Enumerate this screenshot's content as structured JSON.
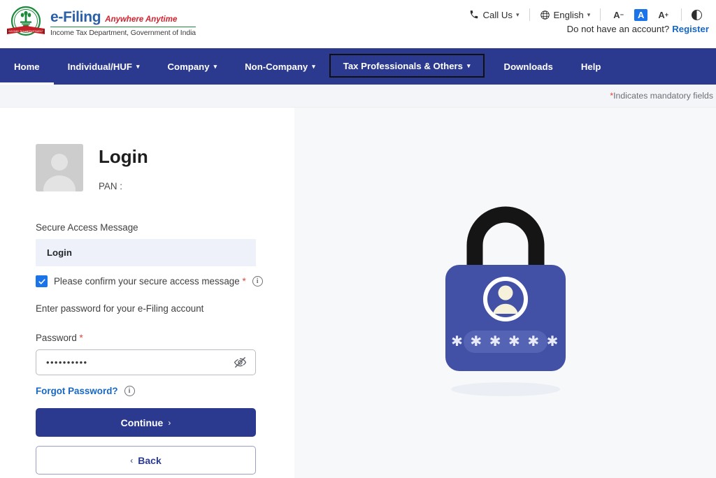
{
  "header": {
    "logo": {
      "emblem_alt": "income-tax-department-emblem",
      "title": "e-Filing",
      "tagline": "Anywhere Anytime",
      "subtitle": "Income Tax Department, Government of India"
    },
    "utilities": [
      {
        "id": "call-us",
        "label": "Call Us",
        "icon": "phone-icon",
        "has_caret": true
      },
      {
        "id": "language",
        "label": "English",
        "icon": "globe-icon",
        "has_caret": true
      }
    ],
    "font_size_controls": {
      "decrease": "A",
      "decrease_sup": "−",
      "normal": "A",
      "increase": "A",
      "increase_sup": "+",
      "active": "normal"
    },
    "contrast_toggle": "contrast-icon",
    "account_prompt": "Do not have an account?",
    "register_label": "Register"
  },
  "nav": {
    "items": [
      {
        "label": "Home",
        "caret": false,
        "state": "active"
      },
      {
        "label": "Individual/HUF",
        "caret": true,
        "state": "normal"
      },
      {
        "label": "Company",
        "caret": true,
        "state": "normal"
      },
      {
        "label": "Non-Company",
        "caret": true,
        "state": "normal"
      },
      {
        "label": "Tax Professionals & Others",
        "caret": true,
        "state": "focused"
      },
      {
        "label": "Downloads",
        "caret": false,
        "state": "normal"
      },
      {
        "label": "Help",
        "caret": false,
        "state": "normal"
      }
    ],
    "background": "#2b3a8f"
  },
  "mandatory": {
    "asterisk": "*",
    "text": " Indicates mandatory fields"
  },
  "login": {
    "title": "Login",
    "pan_label": "PAN :",
    "pan_value": "",
    "secure_access": {
      "label": "Secure Access Message",
      "value": "Login",
      "confirm_label": "Please confirm your secure access message",
      "confirm_required": "*",
      "confirm_checked": true,
      "info_glyph": "i"
    },
    "password": {
      "instruction": "Enter password for your e-Filing account",
      "label": "Password",
      "required": "*",
      "value": "••••••••••",
      "placeholder": "",
      "toggle_icon": "eye-off-icon"
    },
    "forgot_password": "Forgot Password?",
    "forgot_info_glyph": "i",
    "continue_label": "Continue",
    "continue_chevron": "›",
    "back_label": "Back",
    "back_chevron": "‹"
  },
  "illustration": {
    "name": "padlock-user-password-illustration",
    "asterisks": "✱ ✱ ✱ ✱ ✱ ✱",
    "body_color": "#4250a5",
    "shackle_color": "#151515",
    "panel_color": "#5563b4"
  },
  "colors": {
    "brand_blue": "#2b3a8f",
    "link_blue": "#1767c4",
    "accent_blue": "#1a73e8",
    "required_red": "#e0453b",
    "panel_bg": "#f7f8fa"
  }
}
